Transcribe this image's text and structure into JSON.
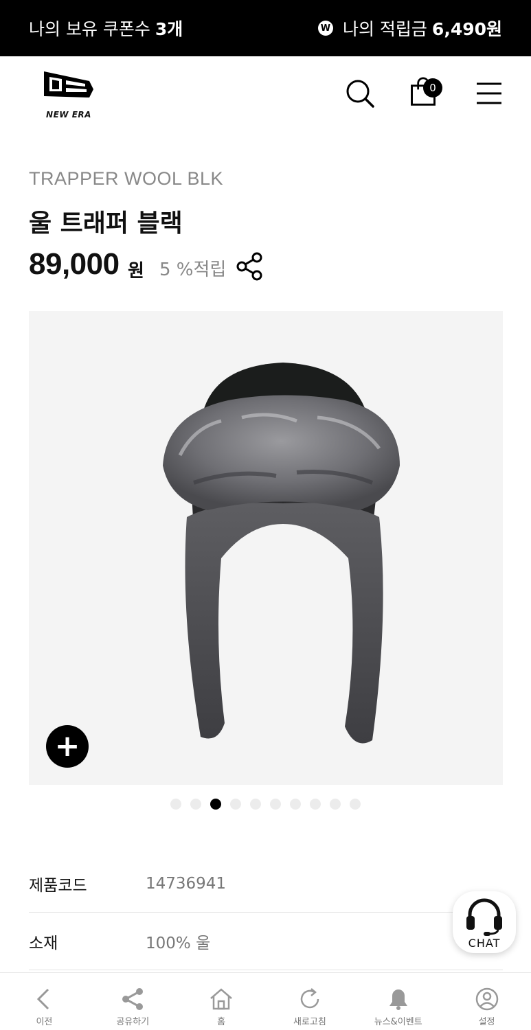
{
  "topbar": {
    "coupon_label": "나의 보유 쿠폰수",
    "coupon_count": "3개",
    "points_badge": "W",
    "points_label": "나의 적립금",
    "points_value": "6,490원"
  },
  "header": {
    "logo_text": "NEW ERA",
    "cart_count": "0",
    "icons": [
      "search-icon",
      "shopping-bag-icon",
      "menu-icon"
    ]
  },
  "product": {
    "name_en": "TRAPPER WOOL BLK",
    "name_ko": "울 트래퍼 블랙",
    "price": "89,000",
    "currency": "원",
    "points_rate": "5 %적립"
  },
  "gallery": {
    "zoom_label": "+",
    "slide_count": 10,
    "active_slide": 3
  },
  "specs": [
    {
      "label": "제품코드",
      "value": "14736941"
    },
    {
      "label": "소재",
      "value": "100% 울"
    }
  ],
  "chat": {
    "label": "CHAT"
  },
  "bottom_nav": [
    {
      "label": "이전",
      "icon": "back-icon"
    },
    {
      "label": "공유하기",
      "icon": "share-icon"
    },
    {
      "label": "홈",
      "icon": "home-icon"
    },
    {
      "label": "새로고침",
      "icon": "refresh-icon"
    },
    {
      "label": "뉴스&이벤트",
      "icon": "bell-icon"
    },
    {
      "label": "설정",
      "icon": "settings-icon"
    }
  ]
}
